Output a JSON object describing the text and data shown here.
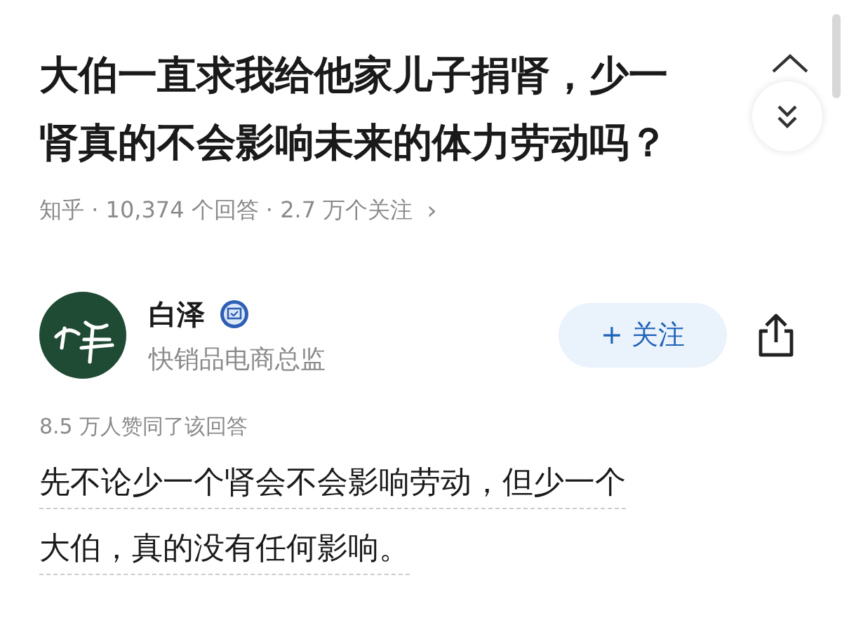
{
  "question": {
    "title_lines": [
      "大伯一直求我给他家儿子捐肾，少一",
      "肾真的不会影响未来的体力劳动吗？"
    ],
    "meta": "知乎 · 10,374 个回答 · 2.7 万个关注",
    "meta_arrow": "›"
  },
  "author": {
    "name": "白泽",
    "verified": true,
    "bio": "快销品电商总监",
    "follow_button": "+ 关注",
    "following": false
  },
  "answer": {
    "votes": "8.5 万人赞同了该回答",
    "lines": [
      "先不论少一个肾会不会影响劳动，但少一个",
      "大伯，真的没有任何影响。"
    ]
  }
}
